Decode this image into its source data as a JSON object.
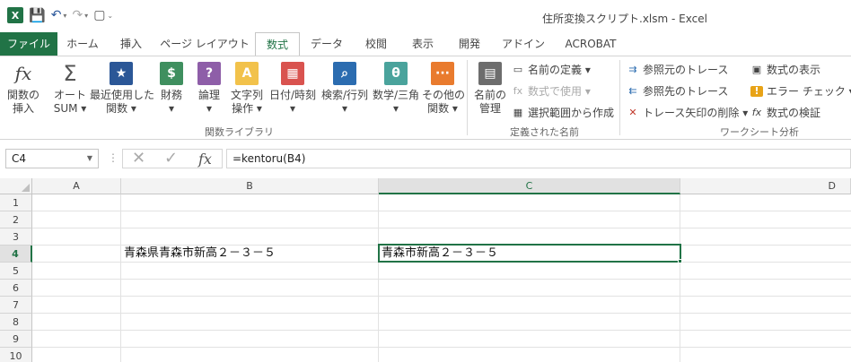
{
  "window": {
    "title": "住所変換スクリプト.xlsm - Excel",
    "logo_letter": "X",
    "qat": {
      "save_icon": "💾",
      "undo_icon": "↶",
      "redo_icon": "↷",
      "new_icon": "▢",
      "customize_icon": "⌄"
    }
  },
  "tabs": [
    {
      "label": "ファイル"
    },
    {
      "label": "ホーム"
    },
    {
      "label": "挿入"
    },
    {
      "label": "ページ レイアウト"
    },
    {
      "label": "数式"
    },
    {
      "label": "データ"
    },
    {
      "label": "校閲"
    },
    {
      "label": "表示"
    },
    {
      "label": "開発"
    },
    {
      "label": "アドイン"
    },
    {
      "label": "ACROBAT"
    }
  ],
  "ribbon": {
    "function_library": {
      "label": "関数ライブラリ",
      "buttons": [
        {
          "label": "関数の\n挿入",
          "icon": "fx"
        },
        {
          "label": "オート\nSUM ▾",
          "icon": "Σ"
        },
        {
          "label": "最近使用した\n関数 ▾",
          "icon": "★"
        },
        {
          "label": "財務\n▾",
          "icon": "$"
        },
        {
          "label": "論理\n▾",
          "icon": "?"
        },
        {
          "label": "文字列\n操作 ▾",
          "icon": "A"
        },
        {
          "label": "日付/時刻\n▾",
          "icon": "▦"
        },
        {
          "label": "検索/行列\n▾",
          "icon": "⌕"
        },
        {
          "label": "数学/三角\n▾",
          "icon": "θ"
        },
        {
          "label": "その他の\n関数 ▾",
          "icon": "···"
        }
      ]
    },
    "defined_names": {
      "label": "定義された名前",
      "manager": {
        "label": "名前の\n管理",
        "icon": "▤"
      },
      "items": [
        {
          "label": "名前の定義 ▾",
          "icon": "▭"
        },
        {
          "label": "数式で使用 ▾",
          "icon": "fx"
        },
        {
          "label": "選択範囲から作成",
          "icon": "▦"
        }
      ]
    },
    "formula_auditing": {
      "label": "ワークシート分析",
      "left_items": [
        {
          "label": "参照元のトレース",
          "icon": "⇉"
        },
        {
          "label": "参照先のトレース",
          "icon": "⇇"
        },
        {
          "label": "トレース矢印の削除 ▾",
          "icon": "✕"
        }
      ],
      "right_items": [
        {
          "label": "数式の表示",
          "icon": "▣"
        },
        {
          "label": "エラー チェック ▾",
          "icon": "!"
        },
        {
          "label": "数式の検証",
          "icon": "fx"
        }
      ]
    }
  },
  "formula_bar": {
    "name_box": "C4",
    "formula": "=kentoru(B4)",
    "cancel_icon": "✕",
    "enter_icon": "✓",
    "fx_icon": "fx"
  },
  "grid": {
    "columns": [
      "A",
      "B",
      "C",
      "D"
    ],
    "rows": [
      "1",
      "2",
      "3",
      "4",
      "5",
      "6",
      "7",
      "8",
      "9",
      "10"
    ],
    "selected_cell": "C4",
    "cells": {
      "B4": "青森県青森市新高２－３－５",
      "C4": "青森市新高２－３－５"
    }
  }
}
